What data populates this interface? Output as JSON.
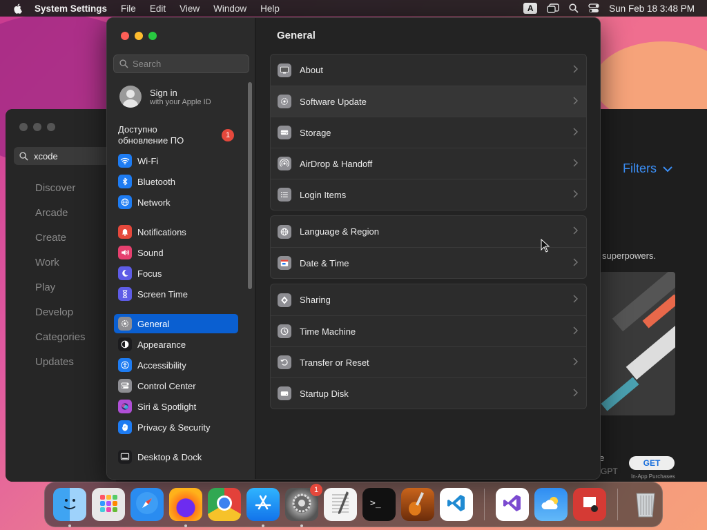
{
  "menubar": {
    "app_name": "System Settings",
    "menus": [
      "File",
      "Edit",
      "View",
      "Window",
      "Help"
    ],
    "input_source": "A",
    "clock": "Sun Feb 18  3:48 PM"
  },
  "appstore_bg": {
    "search_value": "xcode",
    "nav": [
      "Discover",
      "Arcade",
      "Create",
      "Work",
      "Play",
      "Develop",
      "Categories",
      "Updates"
    ],
    "filters_label": "Filters",
    "tagline": "superpowers.",
    "get_label": "GET",
    "in_app": "In-App Purchases",
    "partial_gpt": "GPT",
    "partial_e": "e"
  },
  "settings": {
    "search_placeholder": "Search",
    "account": {
      "title": "Sign in",
      "subtitle": "with your Apple ID"
    },
    "update_notice": {
      "line1": "Доступно",
      "line2": "обновление ПО",
      "badge": "1"
    },
    "sidebar": [
      {
        "label": "Wi-Fi",
        "icon": "wifi-icon",
        "color": "#1e7cf2"
      },
      {
        "label": "Bluetooth",
        "icon": "bluetooth-icon",
        "color": "#1e7cf2"
      },
      {
        "label": "Network",
        "icon": "globe-icon",
        "color": "#1e7cf2"
      },
      {
        "label": "Notifications",
        "icon": "bell-icon",
        "color": "#e5483c"
      },
      {
        "label": "Sound",
        "icon": "speaker-icon",
        "color": "#e5406e"
      },
      {
        "label": "Focus",
        "icon": "moon-icon",
        "color": "#5e5ce6"
      },
      {
        "label": "Screen Time",
        "icon": "hourglass-icon",
        "color": "#5e5ce6"
      },
      {
        "label": "General",
        "icon": "gear-icon",
        "color": "#8e8e93",
        "active": true
      },
      {
        "label": "Appearance",
        "icon": "appearance-icon",
        "color": "#1c1c1e"
      },
      {
        "label": "Accessibility",
        "icon": "accessibility-icon",
        "color": "#1e7cf2"
      },
      {
        "label": "Control Center",
        "icon": "control-center-icon",
        "color": "#8e8e93"
      },
      {
        "label": "Siri & Spotlight",
        "icon": "siri-icon",
        "color": "#b04fd6"
      },
      {
        "label": "Privacy & Security",
        "icon": "hand-icon",
        "color": "#1e7cf2"
      },
      {
        "label": "Desktop & Dock",
        "icon": "dock-icon",
        "color": "#1c1c1e"
      }
    ],
    "content": {
      "title": "General",
      "groups": [
        [
          {
            "label": "About",
            "icon": "computer-icon"
          },
          {
            "label": "Software Update",
            "icon": "gear-update-icon"
          },
          {
            "label": "Storage",
            "icon": "storage-icon"
          },
          {
            "label": "AirDrop & Handoff",
            "icon": "airdrop-icon"
          },
          {
            "label": "Login Items",
            "icon": "list-icon"
          }
        ],
        [
          {
            "label": "Language & Region",
            "icon": "language-globe-icon"
          },
          {
            "label": "Date & Time",
            "icon": "calendar-icon"
          }
        ],
        [
          {
            "label": "Sharing",
            "icon": "sharing-icon"
          },
          {
            "label": "Time Machine",
            "icon": "time-machine-icon"
          },
          {
            "label": "Transfer or Reset",
            "icon": "reset-icon"
          },
          {
            "label": "Startup Disk",
            "icon": "disk-icon"
          }
        ]
      ]
    }
  },
  "dock": {
    "apps": [
      "Finder",
      "Launchpad",
      "Safari",
      "Firefox",
      "Chrome",
      "App Store",
      "System Settings",
      "TextEdit",
      "Terminal",
      "GarageBand",
      "VS Code",
      "Visual Studio",
      "Weather",
      "Photo Booth",
      "Trash"
    ],
    "settings_badge": "1"
  }
}
